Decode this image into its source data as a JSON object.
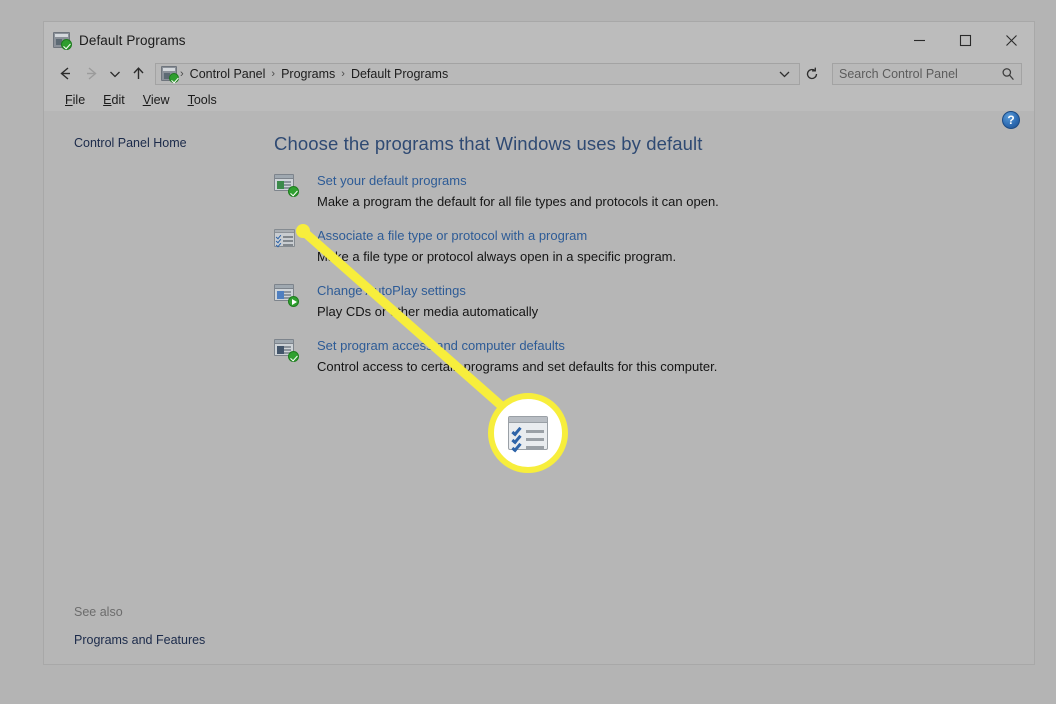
{
  "window": {
    "title": "Default Programs",
    "title_icon": "control-panel-icon",
    "controls": {
      "minimize": "minimize-button",
      "maximize": "maximize-button",
      "close": "close-button"
    }
  },
  "address_bar": {
    "back": "back-arrow-icon",
    "forward": "forward-arrow-icon",
    "recent": "recent-locations-chevron-icon",
    "up": "up-arrow-icon",
    "breadcrumb": [
      "Control Panel",
      "Programs",
      "Default Programs"
    ],
    "separator": "›",
    "dropdown": "breadcrumb-dropdown-icon",
    "refresh": "refresh-icon"
  },
  "search": {
    "placeholder": "Search Control Panel",
    "value": "",
    "icon": "search-icon"
  },
  "menubar": [
    {
      "before": "",
      "accel": "F",
      "after": "ile"
    },
    {
      "before": "",
      "accel": "E",
      "after": "dit"
    },
    {
      "before": "",
      "accel": "V",
      "after": "iew"
    },
    {
      "before": "",
      "accel": "T",
      "after": "ools"
    }
  ],
  "sidebar": {
    "home_link": "Control Panel Home",
    "see_also_label": "See also",
    "see_also_links": [
      "Programs and Features"
    ]
  },
  "content": {
    "heading": "Choose the programs that Windows uses by default",
    "help_label": "?",
    "tasks": [
      {
        "icon": "default-programs-icon",
        "badge": "check",
        "title": "Set your default programs",
        "description": "Make a program the default for all file types and protocols it can open."
      },
      {
        "icon": "file-association-checklist-icon",
        "badge": "none",
        "title": "Associate a file type or protocol with a program",
        "description": "Make a file type or protocol always open in a specific program."
      },
      {
        "icon": "autoplay-icon",
        "badge": "play",
        "title": "Change AutoPlay settings",
        "description": "Play CDs or other media automatically"
      },
      {
        "icon": "program-access-icon",
        "badge": "check",
        "title": "Set program access and computer defaults",
        "description": "Control access to certain programs and set defaults for this computer."
      }
    ]
  },
  "callout": {
    "highlight_color": "#f7ee3c",
    "target_icon": "file-association-checklist-icon",
    "points_to": "Associate a file type or protocol with a program"
  }
}
